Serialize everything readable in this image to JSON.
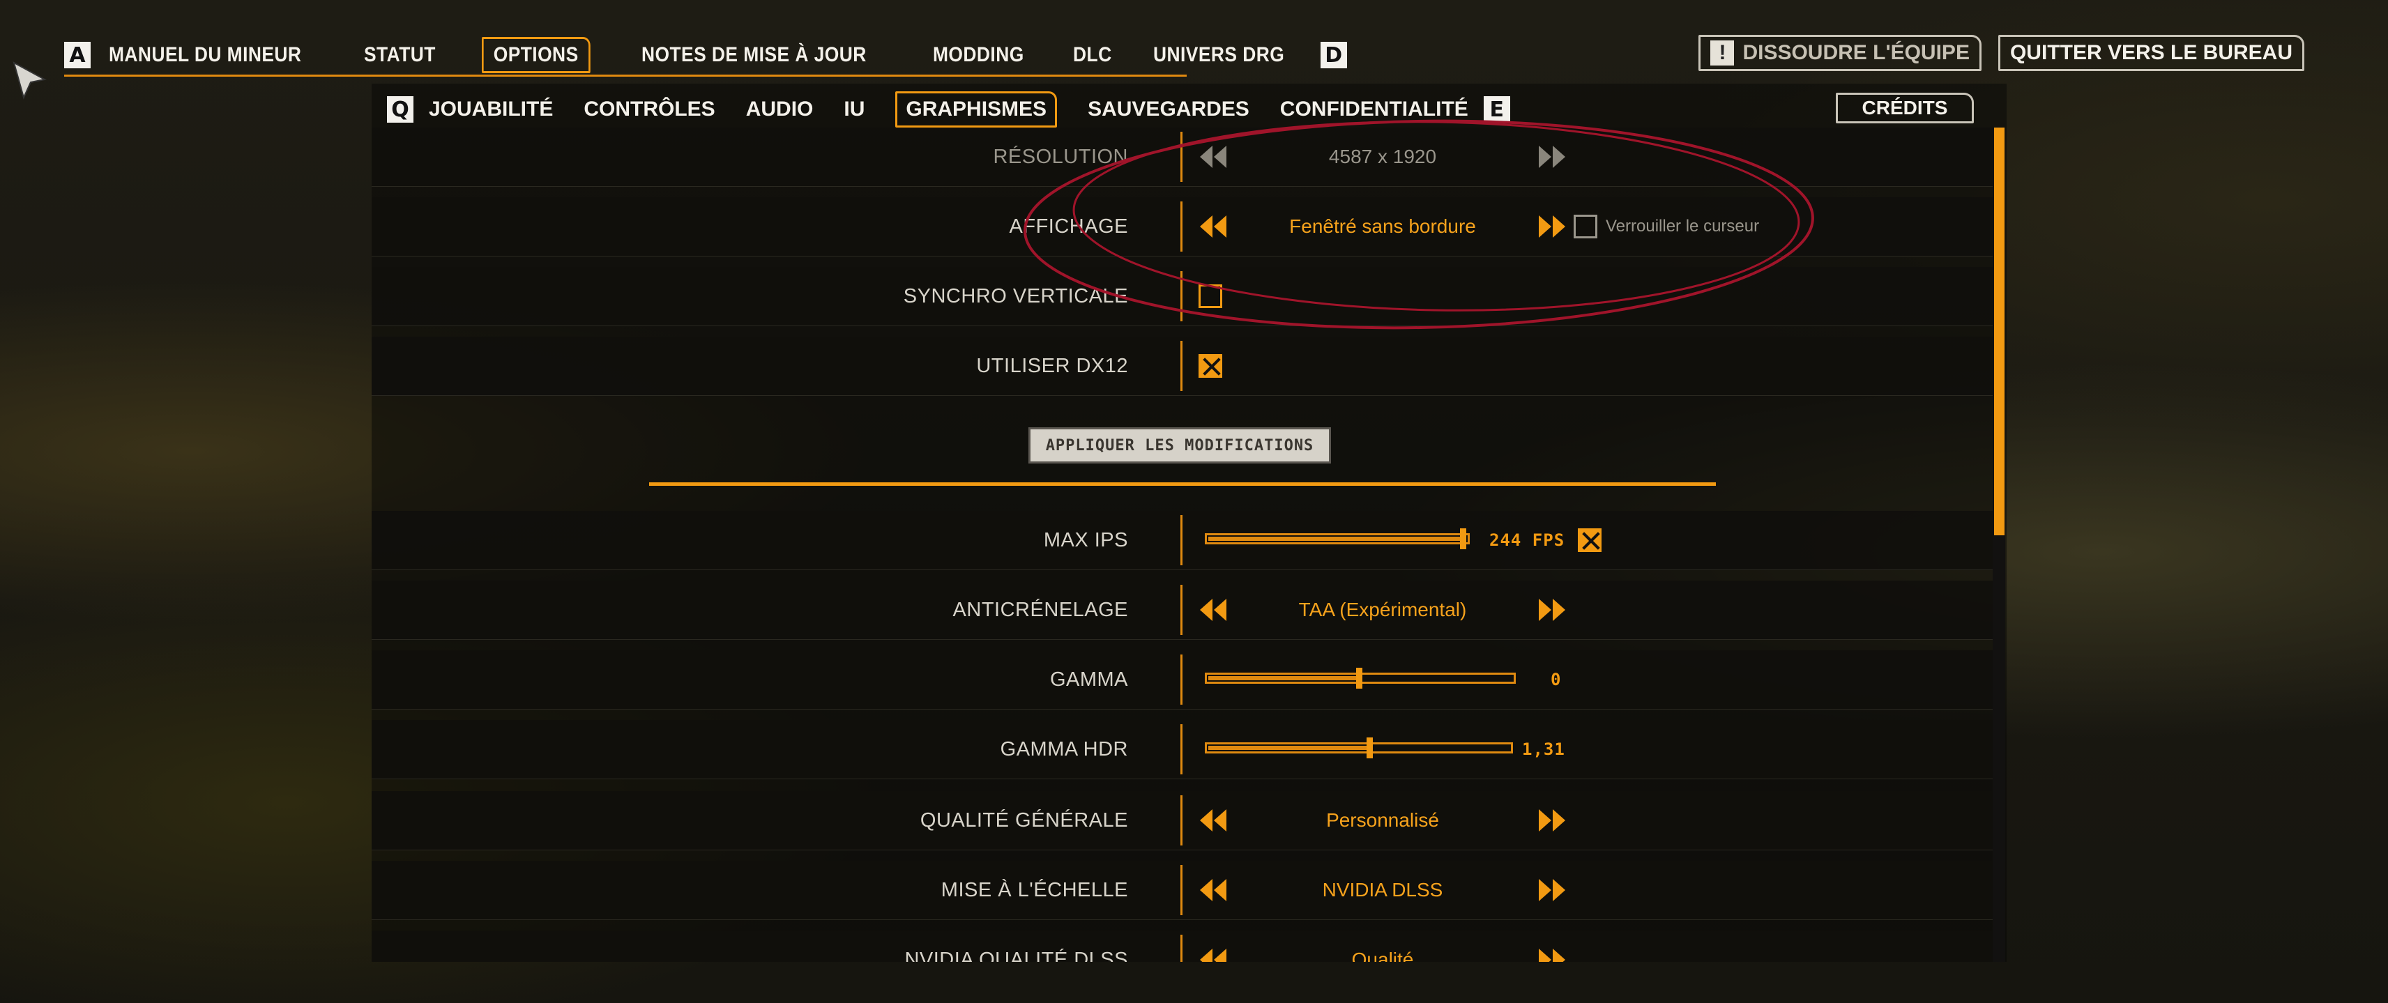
{
  "top_nav": {
    "left_key": "A",
    "right_key": "D",
    "items": [
      "MANUEL DU MINEUR",
      "STATUT",
      "OPTIONS",
      "NOTES DE MISE À JOUR",
      "MODDING",
      "DLC",
      "UNIVERS DRG"
    ],
    "active": "OPTIONS",
    "disband_icon": "!",
    "disband_label": "DISSOUDRE L'ÉQUIPE",
    "quit_label": "QUITTER VERS LE BUREAU"
  },
  "sub_nav": {
    "left_key": "Q",
    "right_key": "E",
    "items": [
      "JOUABILITÉ",
      "CONTRÔLES",
      "AUDIO",
      "IU",
      "GRAPHISMES",
      "SAUVEGARDES",
      "CONFIDENTIALITÉ"
    ],
    "active": "GRAPHISMES",
    "credits_label": "CRÉDITS"
  },
  "settings": {
    "resolution": {
      "label": "RÉSOLUTION",
      "value": "4587 x 1920"
    },
    "display": {
      "label": "AFFICHAGE",
      "value": "Fenêtré sans bordure",
      "lock_label": "Verrouiller le curseur",
      "lock_checked": false
    },
    "vsync": {
      "label": "SYNCHRO VERTICALE",
      "checked": false
    },
    "dx12": {
      "label": "UTILISER DX12",
      "checked": true
    },
    "apply_label": "APPLIQUER LES MODIFICATIONS",
    "max_fps": {
      "label": "MAX IPS",
      "value": "244 FPS",
      "level": 1.0,
      "checked": true
    },
    "antialiasing": {
      "label": "ANTICRÉNELAGE",
      "value": "TAA (Expérimental)"
    },
    "gamma": {
      "label": "GAMMA",
      "value": "0",
      "level": 0.5
    },
    "gamma_hdr": {
      "label": "GAMMA HDR",
      "value": "1,31",
      "level": 0.54
    },
    "overall_quality": {
      "label": "QUALITÉ GÉNÉRALE",
      "value": "Personnalisé"
    },
    "upscaling": {
      "label": "MISE À L'ÉCHELLE",
      "value": "NVIDIA DLSS"
    },
    "dlss_quality": {
      "label": "NVIDIA QUALITÉ DLSS",
      "value": "Qualité"
    }
  },
  "colors": {
    "accent": "#f29a12",
    "highlight_ellipse": "#a0142a"
  }
}
